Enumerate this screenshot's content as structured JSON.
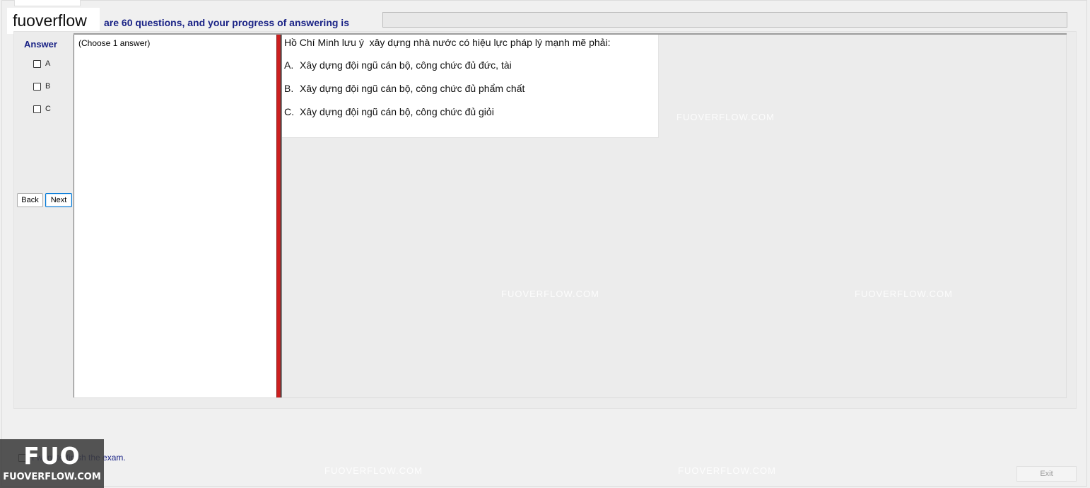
{
  "header": {
    "brand": "fuoverflow",
    "progress_text": "are 60 questions, and your progress of answering is",
    "progress_fraction": 0.0
  },
  "answer_panel": {
    "title": "Answer",
    "options": [
      {
        "label": "A",
        "checked": false
      },
      {
        "label": "B",
        "checked": false
      },
      {
        "label": "C",
        "checked": false
      }
    ],
    "back_label": "Back",
    "next_label": "Next"
  },
  "choose_hint": "(Choose 1 answer)",
  "question": {
    "text": "Hồ Chí Minh lưu ý  xây dựng nhà nước có hiệu lực pháp lý mạnh mẽ phải:",
    "choices": [
      {
        "letter": "A.",
        "text": "Xây dựng đội ngũ cán bộ, công chức đủ đức, tài"
      },
      {
        "letter": "B.",
        "text": "Xây dựng đội ngũ cán bộ, công chức đủ phẩm chất"
      },
      {
        "letter": "C.",
        "text": "Xây dựng đội ngũ cán bộ, công chức đủ giỏi"
      }
    ]
  },
  "watermark": "FUOVERFLOW.COM",
  "footer": {
    "finish_text": "I want to finish the exam.",
    "exit_label": "Exit"
  },
  "logo": {
    "big": "FUO",
    "small": "FUOVERFLOW.COM"
  },
  "colors": {
    "accent_text": "#1a2386",
    "splitter": "#cc1f1f",
    "background": "#f0f0f0"
  }
}
